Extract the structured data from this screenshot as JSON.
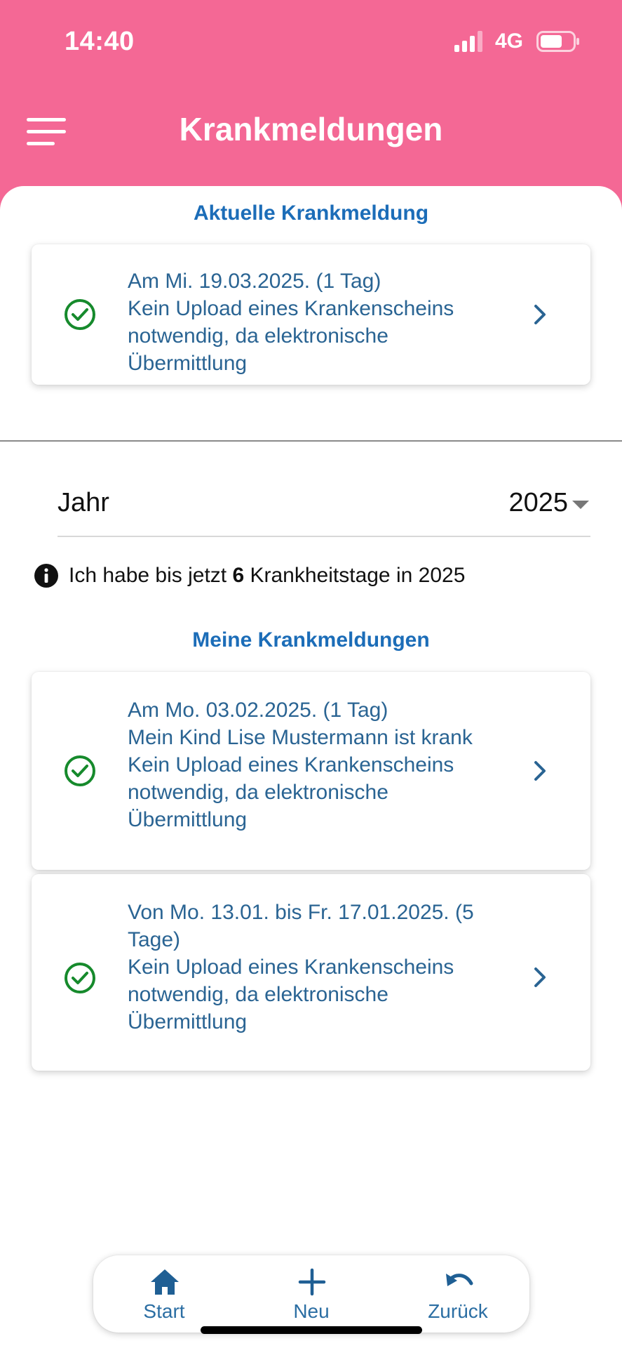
{
  "status_bar": {
    "time": "14:40",
    "network": "4G"
  },
  "header": {
    "title": "Krankmeldungen"
  },
  "current_section": {
    "title": "Aktuelle Krankmeldung",
    "card": {
      "lines": [
        "Am Mi. 19.03.2025. (1 Tag)",
        "Kein Upload eines Krankenscheins",
        "notwendig, da elektronische",
        "Übermittlung"
      ]
    }
  },
  "year_filter": {
    "label": "Jahr",
    "value": "2025"
  },
  "info": {
    "prefix": "Ich habe bis jetzt ",
    "count": "6",
    "suffix": " Krankheitstage in 2025"
  },
  "my_section": {
    "title": "Meine Krankmeldungen",
    "cards": [
      {
        "lines": [
          "Am Mo. 03.02.2025. (1 Tag)",
          "Mein Kind Lise Mustermann ist krank",
          "Kein Upload eines Krankenscheins",
          "notwendig, da elektronische",
          "Übermittlung"
        ]
      },
      {
        "lines": [
          "Von Mo. 13.01. bis Fr. 17.01.2025. (5",
          "Tage)",
          "Kein Upload eines Krankenscheins",
          "notwendig, da elektronische",
          "Übermittlung"
        ]
      }
    ]
  },
  "bottom_nav": {
    "start": "Start",
    "new": "Neu",
    "back": "Zurück"
  },
  "colors": {
    "header_pink": "#f46895",
    "accent_blue": "#1c6db8",
    "card_text_blue": "#2a6493",
    "check_green": "#168a2c",
    "nav_blue": "#2b6ea3"
  }
}
